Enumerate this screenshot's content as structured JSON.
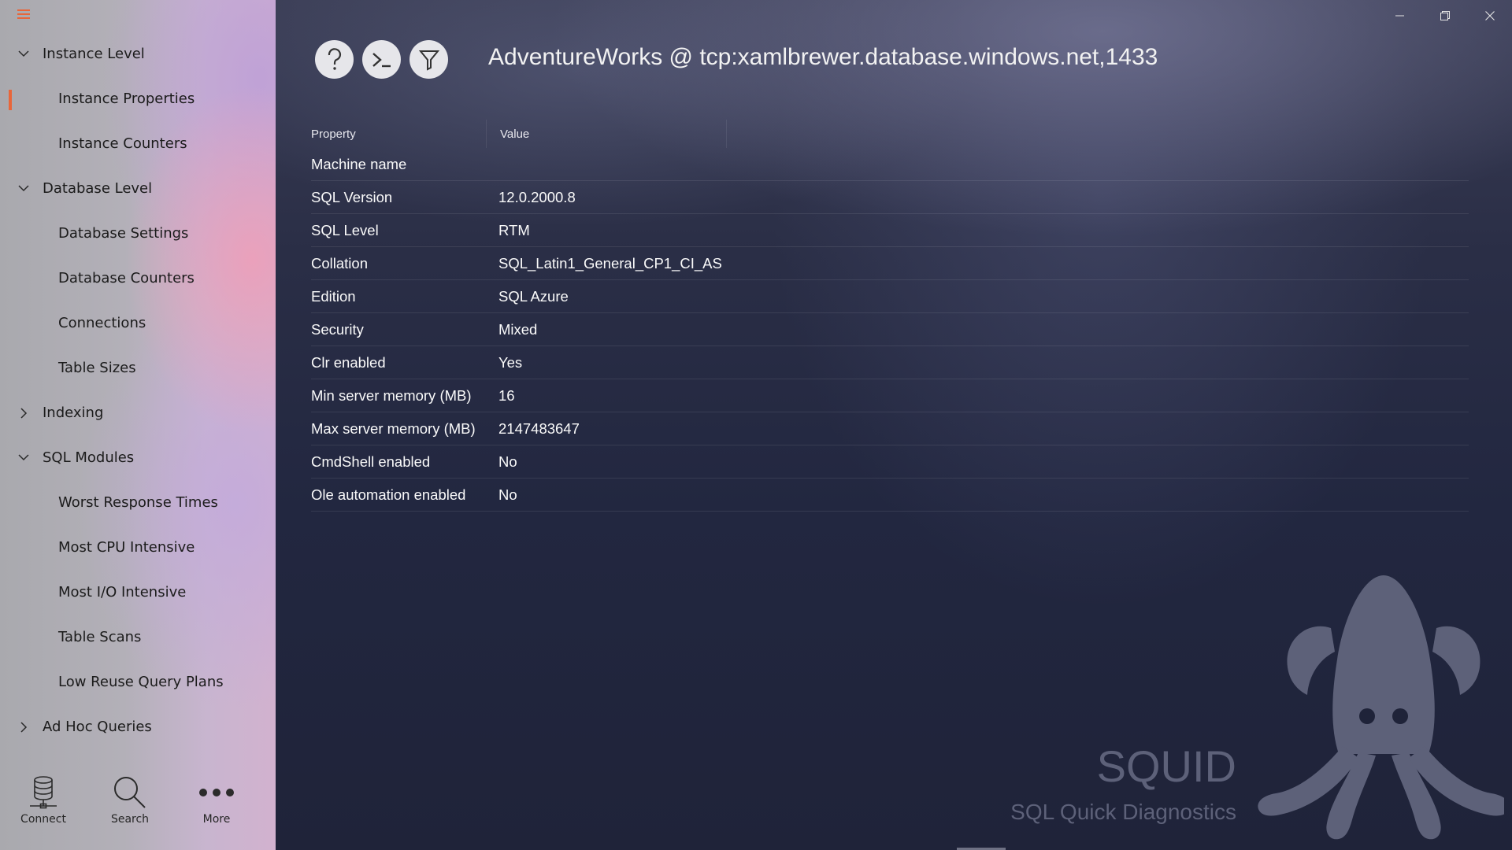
{
  "app": {
    "title": "AdventureWorks @ tcp:xamlbrewer.database.windows.net,1433",
    "accent_color": "#e8663a",
    "menu_icon": "hamburger-icon"
  },
  "nav": {
    "items": [
      {
        "label": "Instance Level",
        "type": "group",
        "expanded": true
      },
      {
        "label": "Instance Properties",
        "type": "child",
        "selected": true
      },
      {
        "label": "Instance Counters",
        "type": "child"
      },
      {
        "label": "Database Level",
        "type": "group",
        "expanded": true
      },
      {
        "label": "Database Settings",
        "type": "child"
      },
      {
        "label": "Database Counters",
        "type": "child"
      },
      {
        "label": "Connections",
        "type": "child"
      },
      {
        "label": "Table Sizes",
        "type": "child"
      },
      {
        "label": "Indexing",
        "type": "group",
        "expanded": false
      },
      {
        "label": "SQL Modules",
        "type": "group",
        "expanded": true
      },
      {
        "label": "Worst Response Times",
        "type": "child"
      },
      {
        "label": "Most CPU Intensive",
        "type": "child"
      },
      {
        "label": "Most I/O Intensive",
        "type": "child"
      },
      {
        "label": "Table Scans",
        "type": "child"
      },
      {
        "label": "Low Reuse Query Plans",
        "type": "child"
      },
      {
        "label": "Ad Hoc Queries",
        "type": "group",
        "expanded": false
      }
    ]
  },
  "bottom_bar": {
    "connect": {
      "label": "Connect",
      "icon": "database-icon"
    },
    "search": {
      "label": "Search",
      "icon": "search-icon"
    },
    "more": {
      "label": "More",
      "icon": "more-icon"
    }
  },
  "toolbar": {
    "help_icon": "help-icon",
    "terminal_icon": "terminal-icon",
    "filter_icon": "filter-icon"
  },
  "grid": {
    "headers": {
      "property": "Property",
      "value": "Value"
    },
    "rows": [
      {
        "property": "Machine name",
        "value": ""
      },
      {
        "property": "SQL Version",
        "value": "12.0.2000.8"
      },
      {
        "property": "SQL Level",
        "value": "RTM"
      },
      {
        "property": "Collation",
        "value": "SQL_Latin1_General_CP1_CI_AS"
      },
      {
        "property": "Edition",
        "value": "SQL Azure"
      },
      {
        "property": "Security",
        "value": "Mixed"
      },
      {
        "property": "Clr enabled",
        "value": "Yes"
      },
      {
        "property": "Min server memory (MB)",
        "value": "16"
      },
      {
        "property": "Max server memory (MB)",
        "value": "2147483647"
      },
      {
        "property": "CmdShell enabled",
        "value": "No"
      },
      {
        "property": "Ole automation enabled",
        "value": "No"
      }
    ]
  },
  "logo": {
    "title": "SQUID",
    "subtitle": "SQL Quick Diagnostics",
    "color": "#5d6179"
  }
}
